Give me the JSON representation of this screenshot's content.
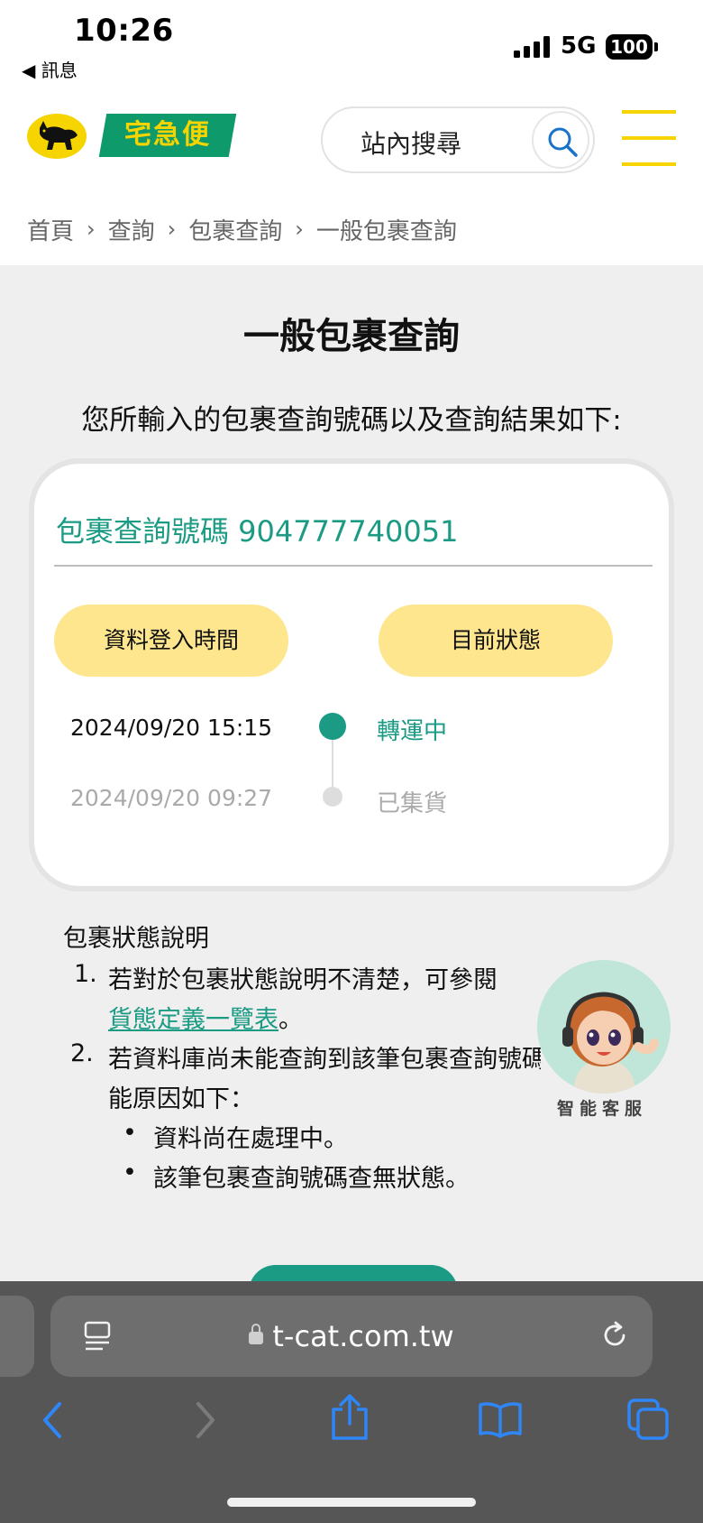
{
  "status_bar": {
    "time": "10:26",
    "back_app": "◀ 訊息",
    "network": "5G",
    "battery": "100"
  },
  "header": {
    "logo_text": "宅急便",
    "search_label": "站內搜尋",
    "brand_color": "#f5d400",
    "accent_color": "#0e9a6a"
  },
  "breadcrumb": {
    "items": [
      "首頁",
      "查詢",
      "包裹查詢",
      "一般包裹查詢"
    ],
    "separator": "›"
  },
  "main": {
    "title": "一般包裹查詢",
    "subtitle": "您所輸入的包裹查詢號碼以及查詢結果如下:"
  },
  "result": {
    "tracking_label": "包裹查詢號碼 904777740051",
    "col_time": "資料登入時間",
    "col_status": "目前狀態",
    "rows": [
      {
        "time": "2024/09/20 15:15",
        "status": "轉運中"
      },
      {
        "time": "2024/09/20 09:27",
        "status": "已集貨"
      }
    ],
    "status_color": "#1b9b84"
  },
  "notes": {
    "title": "包裹狀態說明",
    "item1_num": "1.",
    "item1_text": "若對於包裹狀態說明不清楚，可參閱",
    "item1_link": "貨態定義一覽表",
    "item1_tail": "。",
    "item2_num": "2.",
    "item2_text": "若資料庫尚未能查詢到該筆包裹查詢號碼",
    "item2_text_cont": "能原因如下：",
    "bullet1": "資料尚在處理中。",
    "bullet2": "該筆包裹查詢號碼查無狀態。"
  },
  "assistant": {
    "label": "智能客服"
  },
  "browser": {
    "url": "t-cat.com.tw"
  }
}
